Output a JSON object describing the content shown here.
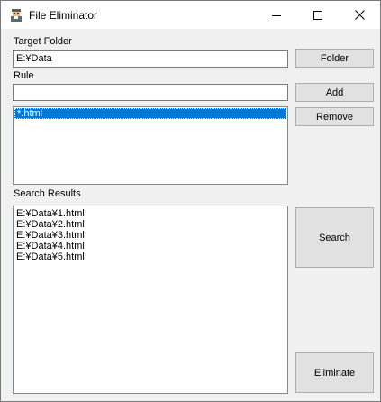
{
  "window": {
    "title": "File Eliminator"
  },
  "target_folder": {
    "label": "Target Folder",
    "value": "E:¥Data",
    "button_label": "Folder"
  },
  "rule": {
    "label": "Rule",
    "value": "",
    "add_label": "Add",
    "remove_label": "Remove",
    "items": [
      {
        "text": "*.html",
        "selected": true
      }
    ]
  },
  "results": {
    "label": "Search Results",
    "items": [
      "E:¥Data¥1.html",
      "E:¥Data¥2.html",
      "E:¥Data¥3.html",
      "E:¥Data¥4.html",
      "E:¥Data¥5.html"
    ],
    "search_label": "Search",
    "eliminate_label": "Eliminate"
  },
  "colors": {
    "selection": "#0078d7",
    "window_bg": "#f0f0f0",
    "button_bg": "#e1e1e1"
  },
  "icons": {
    "app": "app-icon",
    "minimize": "minimize-icon",
    "maximize": "maximize-icon",
    "close": "close-icon"
  }
}
